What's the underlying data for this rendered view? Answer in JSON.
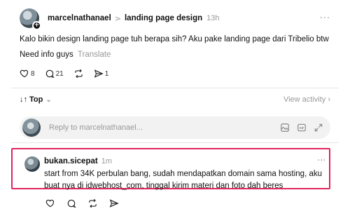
{
  "post": {
    "username": "marcelnathanael",
    "separator": ">",
    "community": "landing page design",
    "time": "13h",
    "more": "···",
    "text": "Kalo bikin design landing page tuh berapa sih? Aku pake landing page dari Tribelio btw",
    "text_line2": "Need info guys",
    "translate": "Translate",
    "likes": "8",
    "replies": "21",
    "shares": "1",
    "icons": [
      "heart-icon",
      "comment-icon",
      "repost-icon",
      "share-icon"
    ]
  },
  "sort": {
    "label": "Top",
    "arrows": "↓↑",
    "chevron": "⌄",
    "view_activity": "View activity ›"
  },
  "reply": {
    "placeholder": "Reply to marcelnathanael...",
    "icons": [
      "image-icon",
      "gif-icon",
      "expand-icon"
    ],
    "gif_label": "GIF"
  },
  "comment": {
    "username": "bukan.sicepat",
    "time": "1m",
    "more": "···",
    "text": "start from 34K perbulan bang, sudah mendapatkan domain sama hosting, aku buat nya di idwebhost_com, tinggal kirim materi dan foto dah beres",
    "icons": [
      "heart-icon",
      "comment-icon",
      "repost-icon",
      "share-icon"
    ]
  },
  "colors": {
    "highlight": "#e0245e",
    "muted": "#999999",
    "text": "#101010"
  }
}
